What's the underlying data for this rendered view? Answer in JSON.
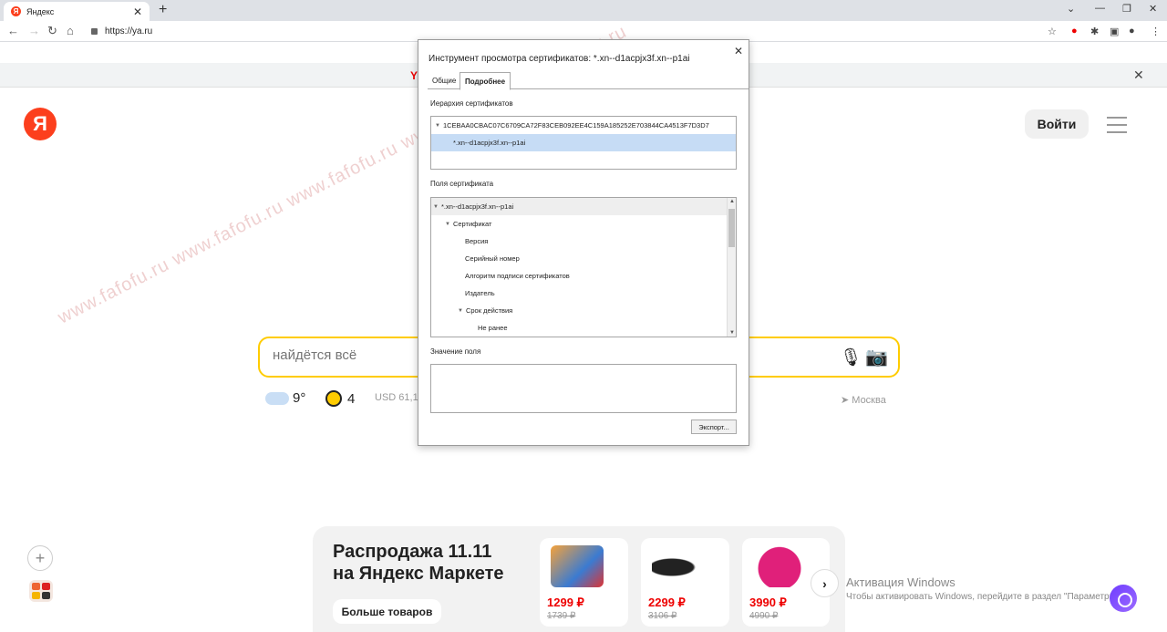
{
  "browser": {
    "tab_title": "Яндекс",
    "tab_close": "✕",
    "new_tab": "+",
    "url": "https://ya.ru"
  },
  "infobar": {
    "label": "Y"
  },
  "header": {
    "logo": "Я",
    "login": "Войти"
  },
  "search": {
    "placeholder": "найдётся всё"
  },
  "infoline": {
    "temperature": "9°",
    "traffic": "4",
    "usd": "USD 61,1",
    "city": "Москва"
  },
  "market": {
    "title": "Распродажа 11.11 на Яндекс Маркете",
    "more_button": "Больше товаров",
    "products": [
      {
        "price": "1299 ₽",
        "old_price": "1739 ₽"
      },
      {
        "price": "2299 ₽",
        "old_price": "3106 ₽"
      },
      {
        "price": "3990 ₽",
        "old_price": "4990 ₽"
      }
    ]
  },
  "activation": {
    "title": "Активация Windows",
    "subtitle": "Чтобы активировать Windows, перейдите в раздел \"Параметры\"."
  },
  "watermark": "www.fafofu.ru www.fafofu.ru www.fafofu.ru www.fafofu.ru www.fafofu.ru",
  "dialog": {
    "title": "Инструмент просмотра сертификатов: *.xn--d1acpjx3f.xn--p1ai",
    "close": "✕",
    "tabs": [
      "Общие",
      "Подробнее"
    ],
    "hierarchy_label": "Иерархия сертификатов",
    "hierarchy": [
      "1CEBAA0CBAC07C6709CA72F83CEB092EE4C159A185252E703844CA4513F7D3D7",
      "*.xn--d1acpjx3f.xn--p1ai"
    ],
    "fields_label": "Поля сертификата",
    "fields": [
      "*.xn--d1acpjx3f.xn--p1ai",
      "Сертификат",
      "Версия",
      "Серийный номер",
      "Алгоритм подписи сертификатов",
      "Издатель",
      "Срок действия",
      "Не ранее"
    ],
    "value_label": "Значение поля",
    "export_button": "Экспорт..."
  }
}
